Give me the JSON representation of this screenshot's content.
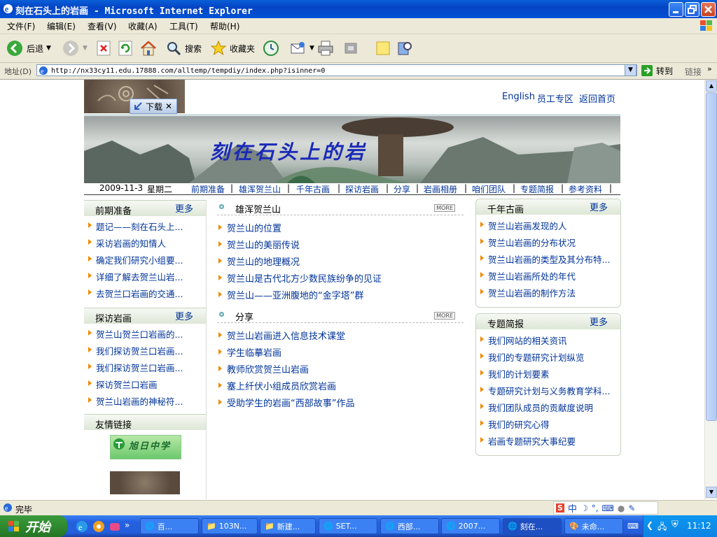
{
  "window": {
    "title": "刻在石头上的岩画 - Microsoft Internet Explorer"
  },
  "menu": [
    "文件(F)",
    "编辑(E)",
    "查看(V)",
    "收藏(A)",
    "工具(T)",
    "帮助(H)"
  ],
  "toolbar": {
    "back": "后退",
    "search": "搜索",
    "favorites": "收藏夹"
  },
  "address": {
    "label": "地址(D)",
    "url": "http://nx33cy11.edu.17888.com/alltemp/tempdiy/index.php?isinner=0",
    "go": "转到",
    "links": "链接"
  },
  "page": {
    "download_tag": "下载",
    "top_links": [
      "English",
      "员工专区",
      "返回首页"
    ],
    "banner_text": "刻在石头上的岩",
    "date": "2009-11-3",
    "weekday": "星期二",
    "nav": [
      "前期准备",
      "雄浑贺兰山",
      "千年古画",
      "探访岩画",
      "分享",
      "岩画相册",
      "咱们团队",
      "专题简报",
      "参考资料"
    ],
    "more": "更多",
    "box_prep": {
      "title": "前期准备",
      "items": [
        "题记——刻在石头上...",
        "采访岩画的知情人",
        "确定我们研究小组要...",
        "详细了解去贺兰山岩...",
        "去贺兰口岩画的交通..."
      ]
    },
    "box_visit": {
      "title": "探访岩画",
      "items": [
        "贺兰山贺兰口岩画的...",
        "我们探访贺兰口岩画...",
        "我们探访贺兰口岩画...",
        "探访贺兰口岩画",
        "贺兰山岩画的神秘符..."
      ]
    },
    "box_links": {
      "title": "友情链接",
      "logo_text": "旭日中学"
    },
    "mid1": {
      "title": "雄浑贺兰山",
      "more": "MORE",
      "items": [
        "贺兰山的位置",
        "贺兰山的美丽传说",
        "贺兰山的地理概况",
        "贺兰山是古代北方少数民族纷争的见证",
        "贺兰山——亚洲腹地的“金字塔”群"
      ]
    },
    "mid2": {
      "title": "分享",
      "more": "MORE",
      "items": [
        "贺兰山岩画进入信息技术课堂",
        "学生临摹岩画",
        "教师欣赏贺兰山岩画",
        "塞上纤伏小组成员欣赏岩画",
        "受助学生的岩画“西部故事”作品"
      ]
    },
    "box_ancient": {
      "title": "千年古画",
      "items": [
        "贺兰山岩画发现的人",
        "贺兰山岩画的分布状况",
        "贺兰山岩画的类型及其分布特...",
        "贺兰山岩画所处的年代",
        "贺兰山岩画的制作方法"
      ]
    },
    "box_brief": {
      "title": "专题简报",
      "items": [
        "我们网站的相关资讯",
        "我们的专题研究计划纵览",
        "我们的计划要素",
        "专题研究计划与义务教育学科...",
        "我们团队成员的贡献度说明",
        "我们的研究心得",
        "岩画专题研究大事纪要"
      ]
    }
  },
  "status": {
    "text": "完毕"
  },
  "taskbar": {
    "start": "开始",
    "tasks": [
      "百...",
      "103N...",
      "新建...",
      "SET...",
      "西部...",
      "2007...",
      "刻在...",
      "未命..."
    ],
    "clock": "11:12"
  },
  "colors": {
    "link": "#003399",
    "bullet": "#f08a00",
    "title_bar": "#0a5fd8",
    "taskbar": "#245edb",
    "start": "#3c9a3c"
  }
}
